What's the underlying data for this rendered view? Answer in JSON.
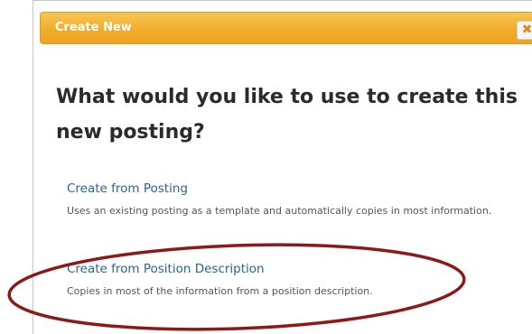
{
  "dialog": {
    "title": "Create New",
    "close_glyph": "✖",
    "close_icon": "close-icon",
    "heading": "What would you like to use to create this new posting?"
  },
  "options": [
    {
      "label": "Create from Posting",
      "description": "Uses an existing posting as a template and automatically copies in most information."
    },
    {
      "label": "Create from Position Description",
      "description": "Copies in most of the information from a position description."
    }
  ],
  "annotation": {
    "shape": "ellipse",
    "color": "#8b1a1a",
    "encircles": "Create from Position Description"
  },
  "colors": {
    "titlebar": "#f1ac2b",
    "link": "#2a6496",
    "heading": "#2b2b2b"
  }
}
